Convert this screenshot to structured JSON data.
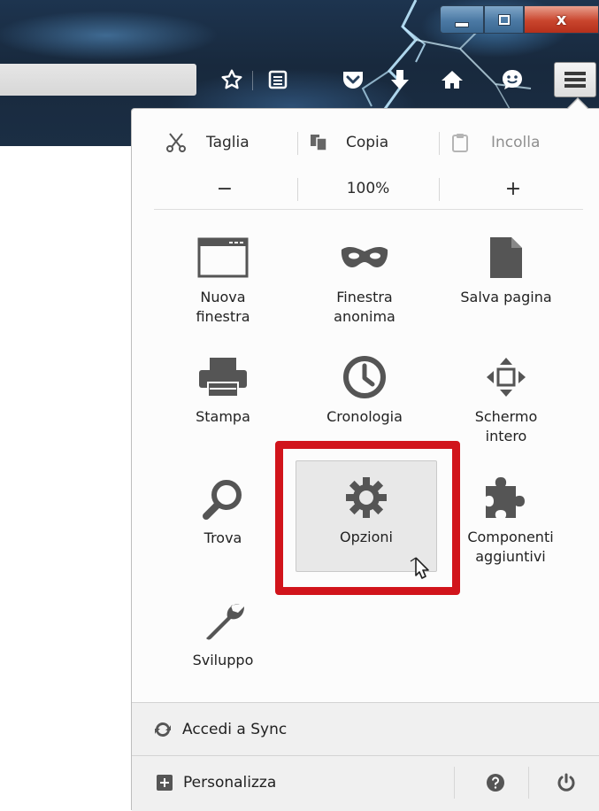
{
  "window_controls": {
    "minimize": "minimize-icon",
    "maximize": "maximize-icon",
    "close": "close-icon",
    "close_glyph": "x"
  },
  "toolbar": {
    "icons": [
      "bookmark-star-icon",
      "reading-list-icon",
      "pocket-icon",
      "download-icon",
      "home-icon",
      "hello-chat-icon",
      "hamburger-menu-icon"
    ]
  },
  "menu": {
    "edit": {
      "cut": "Taglia",
      "copy": "Copia",
      "paste": "Incolla",
      "paste_disabled": true
    },
    "zoom": {
      "minus": "−",
      "level": "100%",
      "plus": "+"
    },
    "items": [
      {
        "label": "Nuova\nfinestra",
        "icon": "new-window-icon"
      },
      {
        "label": "Finestra\nanonima",
        "icon": "private-mask-icon"
      },
      {
        "label": "Salva pagina",
        "icon": "save-page-icon"
      },
      {
        "label": "Stampa",
        "icon": "print-icon"
      },
      {
        "label": "Cronologia",
        "icon": "history-clock-icon"
      },
      {
        "label": "Schermo\nintero",
        "icon": "fullscreen-icon"
      },
      {
        "label": "Trova",
        "icon": "search-icon"
      },
      {
        "label": "Opzioni",
        "icon": "gear-icon"
      },
      {
        "label": "Componenti\naggiuntivi",
        "icon": "puzzle-addons-icon"
      },
      {
        "label": "Sviluppo",
        "icon": "wrench-icon"
      }
    ],
    "highlighted_item": "Opzioni",
    "highlight_color": "#d1141b",
    "footer": {
      "sync": "Accedi a Sync",
      "customize": "Personalizza"
    }
  }
}
